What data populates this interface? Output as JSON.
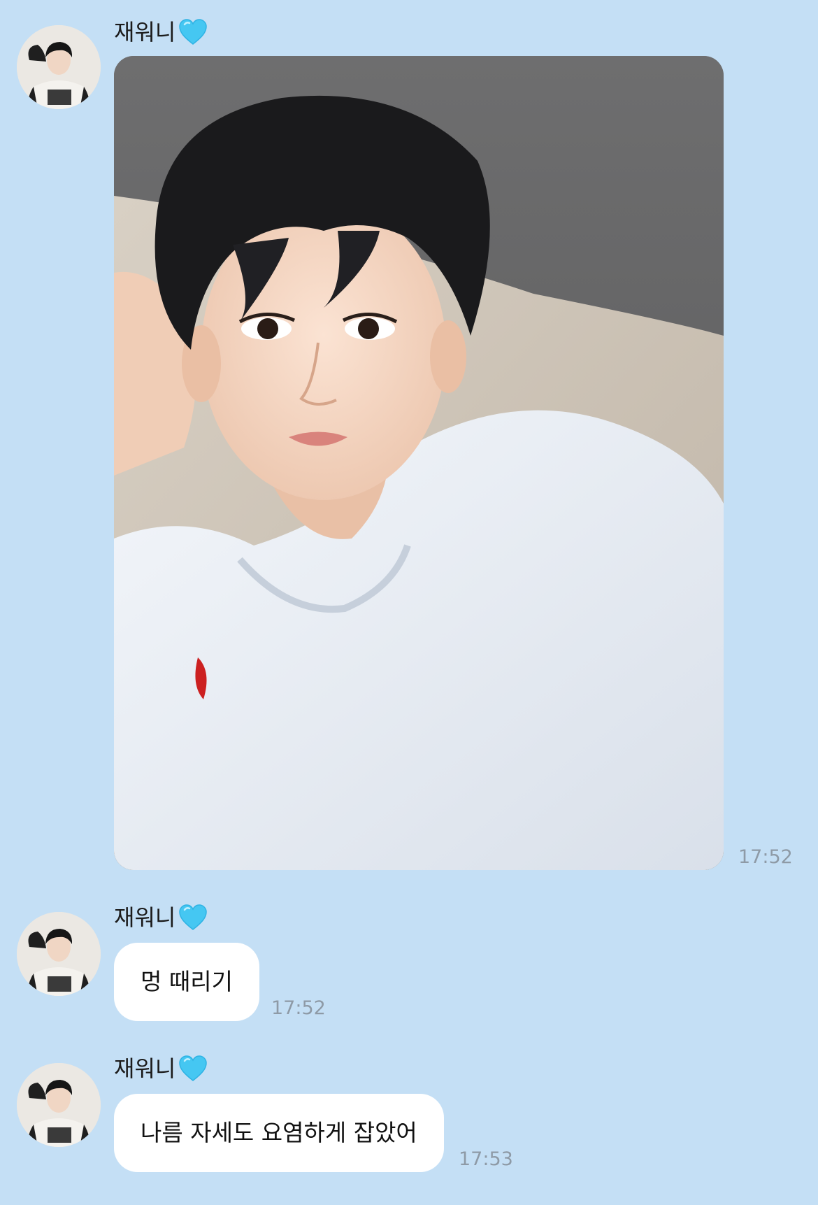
{
  "colors": {
    "background": "#c4dff5",
    "bubble": "#ffffff",
    "timestamp": "#8e9aa6",
    "heart": "#45c7f2"
  },
  "messages": [
    {
      "sender": "재워니",
      "sender_icon": "light-blue-heart-icon",
      "type": "photo",
      "photo_alt": "selfie photo",
      "time": "17:52"
    },
    {
      "sender": "재워니",
      "sender_icon": "light-blue-heart-icon",
      "type": "text",
      "text": "멍 때리기",
      "time": "17:52"
    },
    {
      "sender": "재워니",
      "sender_icon": "light-blue-heart-icon",
      "type": "text",
      "text": "나름 자세도 요염하게 잡았어",
      "time": "17:53"
    }
  ]
}
